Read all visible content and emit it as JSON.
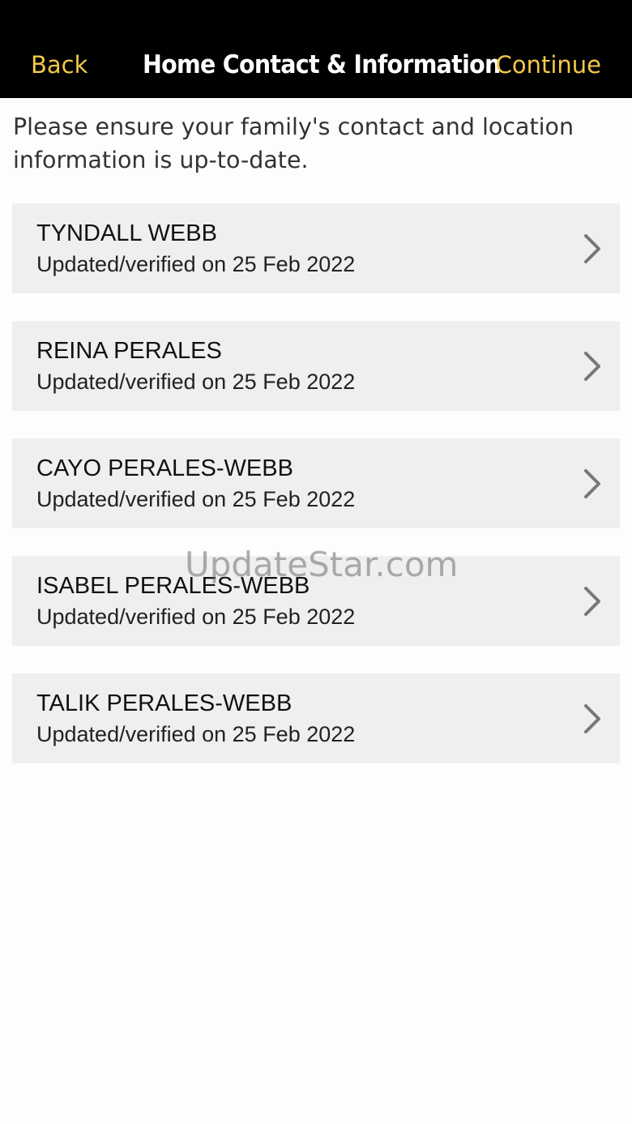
{
  "nav": {
    "back_label": "Back",
    "title": "Home Contact & Information",
    "continue_label": "Continue"
  },
  "intro_text": "Please ensure your family's contact and location information is up-to-date.",
  "contacts": [
    {
      "name": "TYNDALL WEBB",
      "updated": "Updated/verified on 25 Feb 2022"
    },
    {
      "name": "REINA PERALES",
      "updated": "Updated/verified on 25 Feb 2022"
    },
    {
      "name": "CAYO PERALES-WEBB",
      "updated": "Updated/verified on 25 Feb 2022"
    },
    {
      "name": "ISABEL PERALES-WEBB",
      "updated": "Updated/verified on 25 Feb 2022"
    },
    {
      "name": "TALIK PERALES-WEBB",
      "updated": "Updated/verified on 25 Feb 2022"
    }
  ],
  "watermark": "UpdateStar.com",
  "icons": {
    "row_chevron": "chevron-right-icon"
  },
  "colors": {
    "nav_background": "#000000",
    "nav_accent": "#f3c84a",
    "card_background": "#efefef",
    "chevron": "#777777"
  }
}
